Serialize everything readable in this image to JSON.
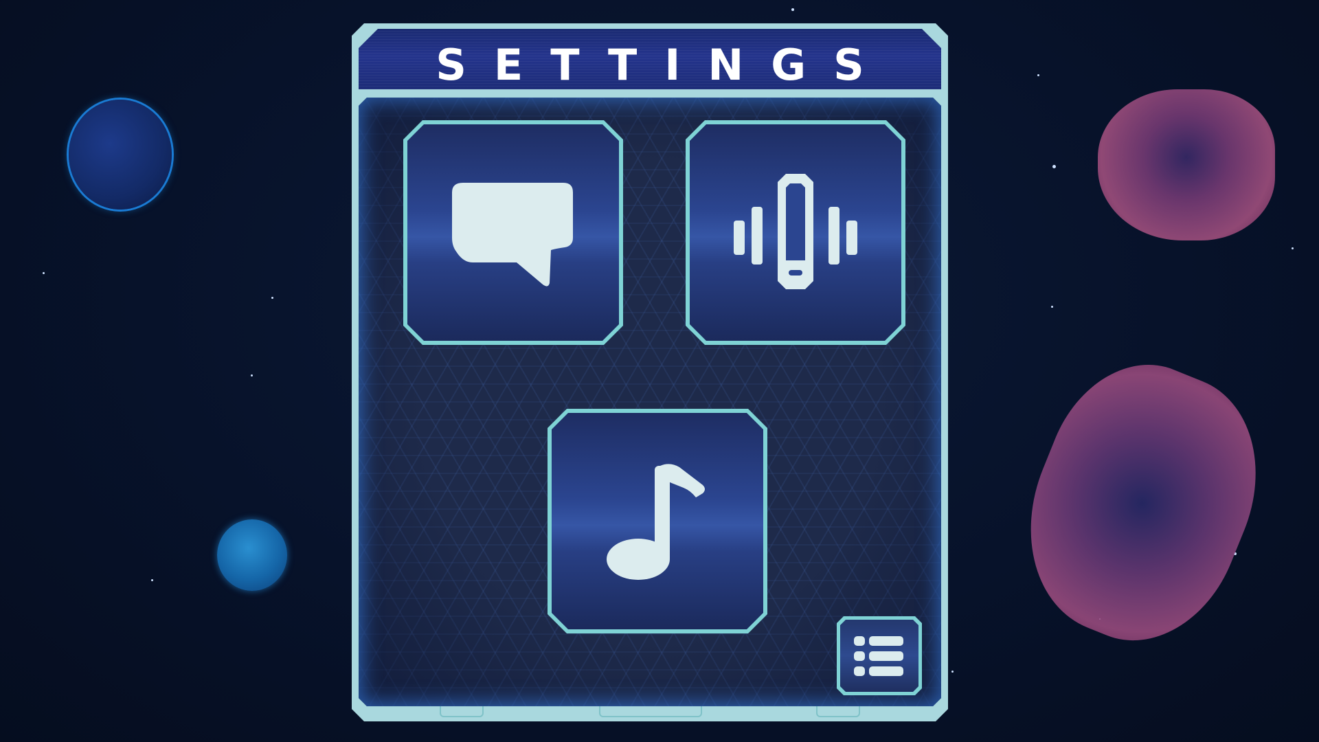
{
  "header": {
    "title": "SETTINGS"
  },
  "buttons": [
    {
      "id": "chat",
      "icon": "speech-bubble-icon"
    },
    {
      "id": "vibration",
      "icon": "phone-vibrate-icon"
    },
    {
      "id": "music",
      "icon": "music-note-icon"
    },
    {
      "id": "menu",
      "icon": "list-menu-icon"
    }
  ],
  "colors": {
    "panel_border": "#a9d8de",
    "tile_border": "#7fd3d5",
    "icon_fill": "#dcecee",
    "header_bg": "#1d2c78",
    "space_bg": "#07122a"
  }
}
